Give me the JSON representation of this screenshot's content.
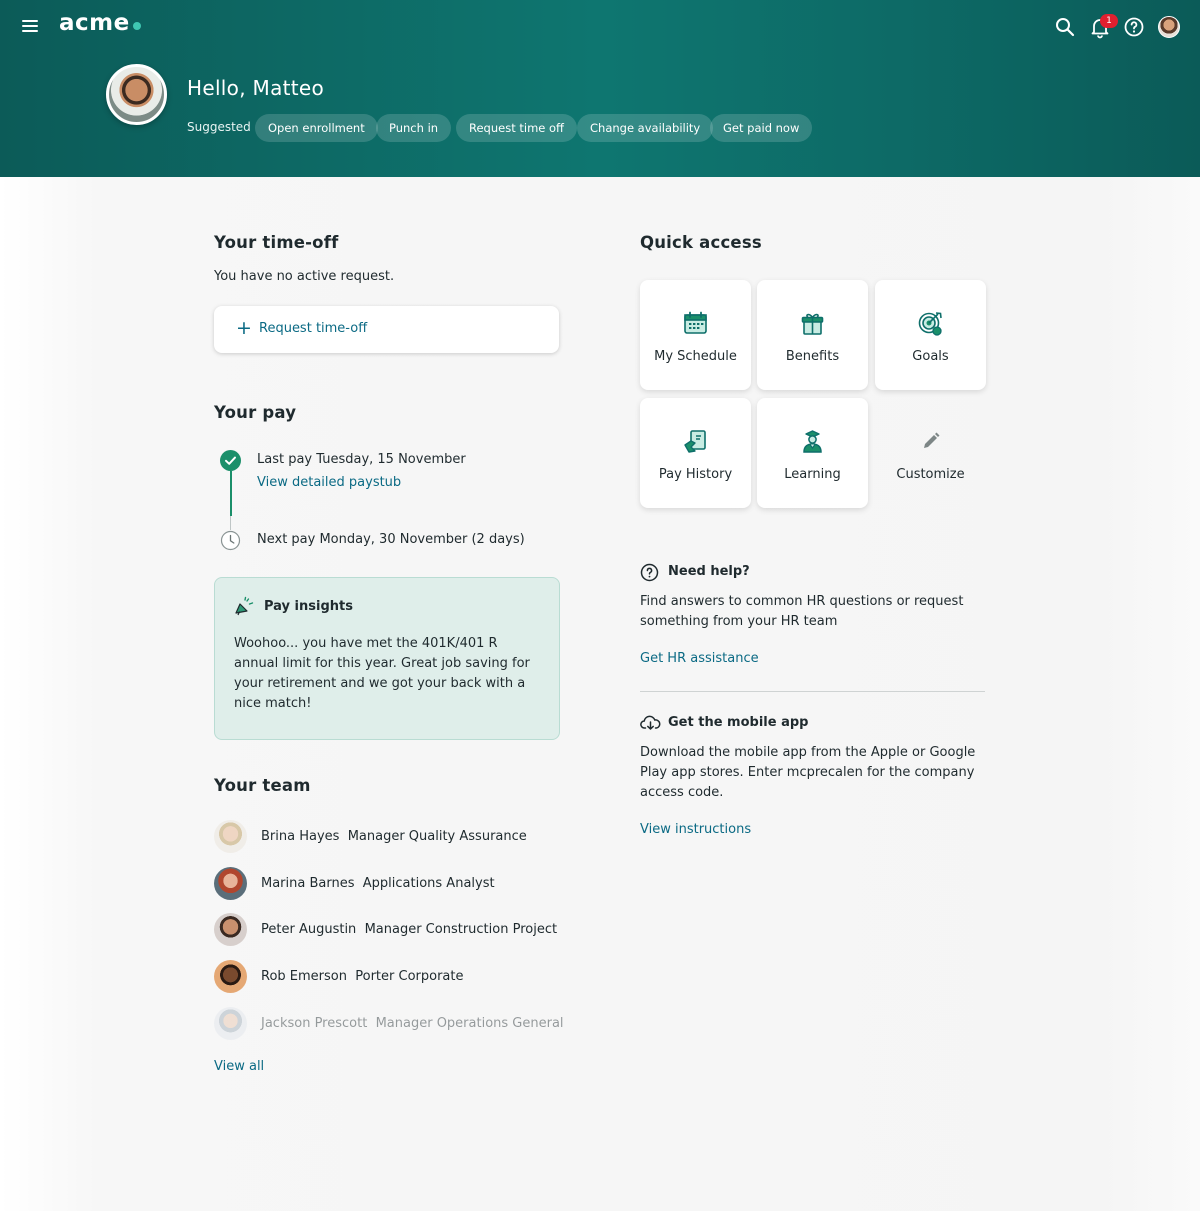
{
  "app": {
    "logo": "acme"
  },
  "header": {
    "notifications_count": "1",
    "greeting": "Hello, Matteo",
    "suggested_label": "Suggested",
    "chips": [
      "Open enrollment",
      "Punch in",
      "Request time off",
      "Change availability",
      "Get paid now"
    ]
  },
  "time_off": {
    "title": "Your time-off",
    "status": "You have no active request.",
    "request_button": "Request time-off"
  },
  "pay": {
    "title": "Your pay",
    "last_pay": "Last pay Tuesday, 15 November",
    "paystub_link": "View detailed paystub",
    "next_pay": "Next pay Monday, 30 November (2 days)"
  },
  "insights": {
    "title": "Pay insights",
    "body": "Woohoo... you have met the 401K/401 R annual limit for this year. Great job saving for your retirement and we got your back with a nice match!"
  },
  "team": {
    "title": "Your team",
    "members": [
      {
        "name": "Brina Hayes",
        "role": "Manager Quality Assurance"
      },
      {
        "name": "Marina Barnes",
        "role": "Applications Analyst"
      },
      {
        "name": "Peter Augustin",
        "role": "Manager Construction Project"
      },
      {
        "name": "Rob Emerson",
        "role": "Porter Corporate"
      },
      {
        "name": "Jackson Prescott",
        "role": "Manager Operations General"
      }
    ],
    "view_all": "View all"
  },
  "quick_access": {
    "title": "Quick access",
    "tiles": [
      "My Schedule",
      "Benefits",
      "Goals",
      "Pay History",
      "Learning",
      "Customize"
    ]
  },
  "help": {
    "title": "Need help?",
    "body": "Find answers to common HR questions or request something from your HR team",
    "link": "Get HR assistance"
  },
  "mobile": {
    "title": "Get the mobile app",
    "body": "Download the mobile app from the Apple or Google Play app stores. Enter mcprecalen for the company access code.",
    "link": "View instructions"
  },
  "colors": {
    "brand_teal": "#0e7670",
    "accent_green": "#1b8f6a",
    "link_blue": "#0b6a84",
    "badge_red": "#e0202f"
  }
}
